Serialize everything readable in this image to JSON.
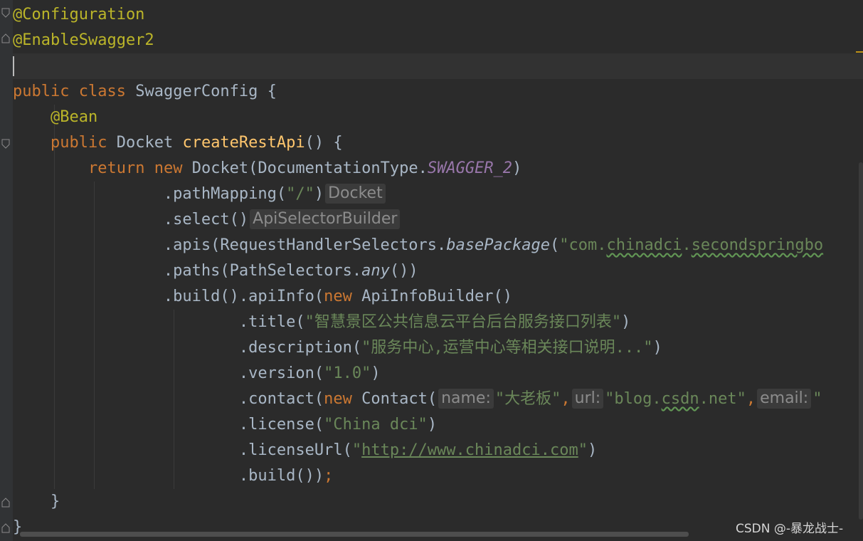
{
  "editor": {
    "lines": {
      "l1": {
        "ann": "@Configuration"
      },
      "l2": {
        "ann": "@EnableSwagger2"
      },
      "l4": {
        "kw1": "public",
        "kw2": "class",
        "name": "SwaggerConfig",
        "brace": "{"
      },
      "l5": {
        "ann": "@Bean"
      },
      "l6": {
        "kw": "public",
        "type": "Docket",
        "method": "createRestApi",
        "rest": "() {"
      },
      "l7": {
        "kw1": "return",
        "kw2": "new",
        "text": "Docket(DocumentationType.",
        "const": "SWAGGER_2",
        "close": ")"
      },
      "l8": {
        "method": ".pathMapping(",
        "str": "\"/\"",
        "close": ")",
        "hint": "Docket"
      },
      "l9": {
        "method": ".select()",
        "hint": "ApiSelectorBuilder"
      },
      "l10": {
        "method": ".apis(RequestHandlerSelectors.",
        "static": "basePackage",
        "paren": "(",
        "str_a": "\"com.",
        "str_b": "chinadci",
        "str_c": ".",
        "str_d": "secondspringbo"
      },
      "l11": {
        "method": ".paths(PathSelectors.",
        "static": "any",
        "close": "())"
      },
      "l12": {
        "method": ".build().apiInfo(",
        "kw": "new",
        "rest": " ApiInfoBuilder()"
      },
      "l13": {
        "method": ".title(",
        "str": "\"智慧景区公共信息云平台后台服务接口列表\"",
        "close": ")"
      },
      "l14": {
        "method": ".description(",
        "str": "\"服务中心,运营中心等相关接口说明...\"",
        "close": ")"
      },
      "l15": {
        "method": ".version(",
        "str": "\"1.0\"",
        "close": ")"
      },
      "l16": {
        "method": ".contact(",
        "kw": "new",
        "rest": " Contact(",
        "hint_name": "name:",
        "str_name": "\"大老板\"",
        "comma1": ",",
        "hint_url": "url:",
        "str_url_a": "\"blog.",
        "str_url_b": "csdn",
        "str_url_c": ".net\"",
        "comma2": ",",
        "hint_email": "email:",
        "tail": "\""
      },
      "l17": {
        "method": ".license(",
        "str": "\"China dci\"",
        "close": ")"
      },
      "l18": {
        "method": ".licenseUrl(",
        "q1": "\"",
        "url": "http://www.chinadci.com",
        "q2": "\"",
        "close": ")"
      },
      "l19": {
        "method": ".build())",
        "semi": ";"
      },
      "l20": {
        "brace": "}"
      },
      "l21": {
        "brace": "}"
      }
    }
  },
  "watermark": "CSDN @-暴龙战士-",
  "colors": {
    "background": "#2b2b2b",
    "keyword": "#cc7832",
    "annotation": "#bbb529",
    "string": "#6a8759",
    "method_decl": "#ffc66d",
    "constant": "#9876aa",
    "default_text": "#a9b7c6"
  }
}
